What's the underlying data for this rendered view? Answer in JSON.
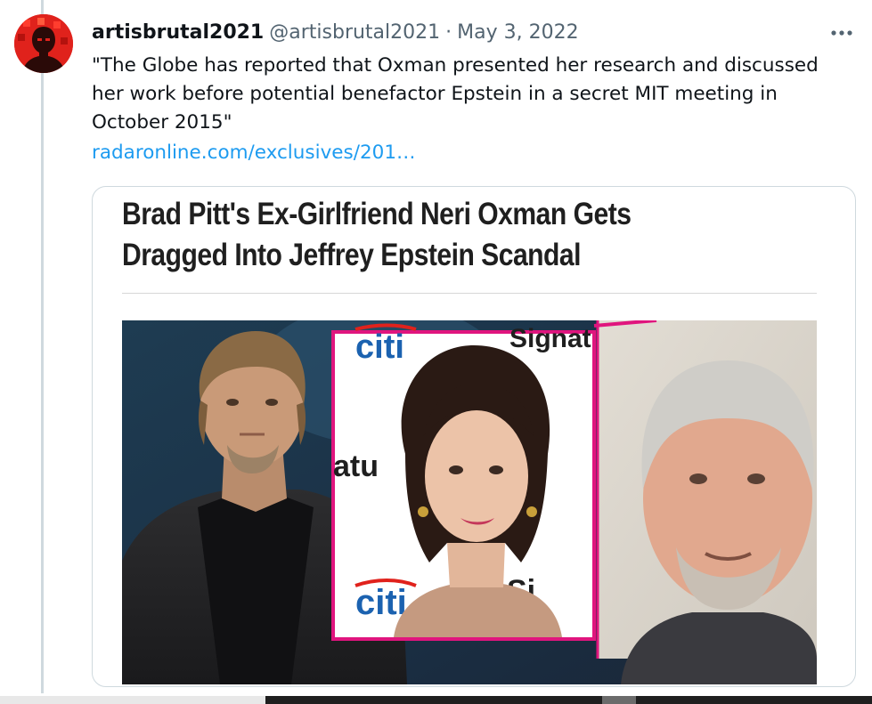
{
  "tweet": {
    "author": {
      "display_name": "artisbrutal2021",
      "handle": "@artisbrutal2021",
      "avatar_icon": "red-silhouette-avatar"
    },
    "separator": "·",
    "date": "May 3, 2022",
    "more_icon": "more-horizontal-icon",
    "text": "\"The Globe has reported that Oxman presented her research and discussed her work before potential benefactor Epstein in a secret MIT meeting in October 2015\"",
    "link": "radaronline.com/exclusives/201…"
  },
  "card": {
    "headline_line1": "Brad Pitt's Ex-Girlfriend Neri Oxman Gets",
    "headline_line2": "Dragged Into Jeffrey Epstein Scandal",
    "image": {
      "left_panel_description_icon": "man-photo",
      "middle_panel_backdrop_top_left": "citi",
      "middle_panel_backdrop_top_right": "Signat",
      "middle_panel_backdrop_mid_left": "atu",
      "middle_panel_backdrop_bottom_left": "citi",
      "middle_panel_backdrop_bottom_right": "Si"
    }
  },
  "colors": {
    "link": "#1d9bf0",
    "text_primary": "#0f1419",
    "text_secondary": "#536471",
    "border": "#cfd9de",
    "avatar_red": "#e0221c",
    "frame_pink": "#e0157e"
  }
}
